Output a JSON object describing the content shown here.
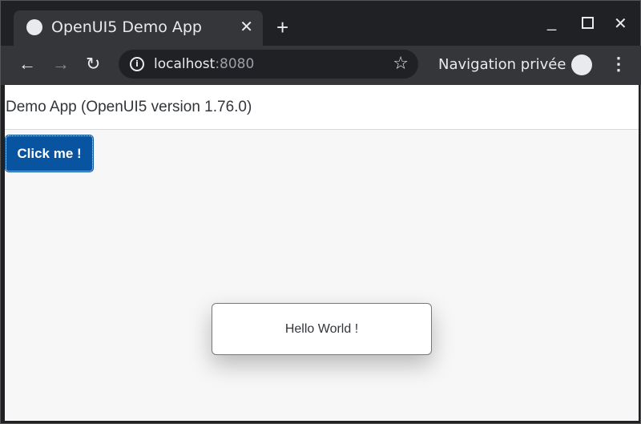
{
  "browser": {
    "tab_title": "OpenUI5 Demo App",
    "url_host": "localhost",
    "url_port": ":8080",
    "incognito_label": "Navigation privée"
  },
  "app": {
    "header_title": "Demo App (OpenUI5 version 1.76.0)",
    "button_label": "Click me !",
    "toast_message": "Hello World !",
    "accent_color": "#0854a0"
  }
}
